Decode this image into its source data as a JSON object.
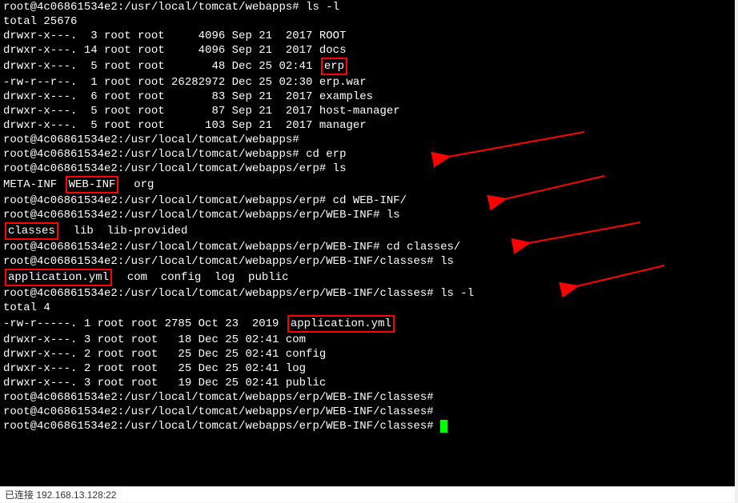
{
  "prompt_webapps": "root@4c06861534e2:/usr/local/tomcat/webapps#",
  "prompt_erp": "root@4c06861534e2:/usr/local/tomcat/webapps/erp#",
  "prompt_webinf": "root@4c06861534e2:/usr/local/tomcat/webapps/erp/WEB-INF#",
  "prompt_classes": "root@4c06861534e2:/usr/local/tomcat/webapps/erp/WEB-INF/classes#",
  "cmd_lsl": "ls -l",
  "cmd_cderp": "cd erp",
  "cmd_ls": "ls",
  "cmd_cdwebinf": "cd WEB-INF/",
  "cmd_cdclasses": "cd classes/",
  "total1": "total 25676",
  "ls1": [
    "drwxr-x---.  3 root root     4096 Sep 21  2017 ROOT",
    "drwxr-x---. 14 root root     4096 Sep 21  2017 docs",
    "drwxr-x---.  5 root root       48 Dec 25 02:41",
    "-rw-r--r--.  1 root root 26282972 Dec 25 02:30 erp.war",
    "drwxr-x---.  6 root root       83 Sep 21  2017 examples",
    "drwxr-x---.  5 root root       87 Sep 21  2017 host-manager",
    "drwxr-x---.  5 root root      103 Sep 21  2017 manager"
  ],
  "erp_text": "erp",
  "erp_ls": {
    "p1": "META-INF ",
    "webinf": "WEB-INF",
    "p2": "  org"
  },
  "webinf_ls": {
    "classes": "classes",
    "rest": "  lib  lib-provided"
  },
  "classes_ls": {
    "app": "application.yml",
    "rest": "  com  config  log  public"
  },
  "total2": "total 4",
  "ls2pre": "-rw-r-----. 1 root root 2785 Oct 23  2019 ",
  "ls2app": "application.yml",
  "ls2rest": [
    "drwxr-x---. 3 root root   18 Dec 25 02:41 com",
    "drwxr-x---. 2 root root   25 Dec 25 02:41 config",
    "drwxr-x---. 2 root root   25 Dec 25 02:41 log",
    "drwxr-x---. 3 root root   19 Dec 25 02:41 public"
  ],
  "status": "已连接 192.168.13.128:22"
}
